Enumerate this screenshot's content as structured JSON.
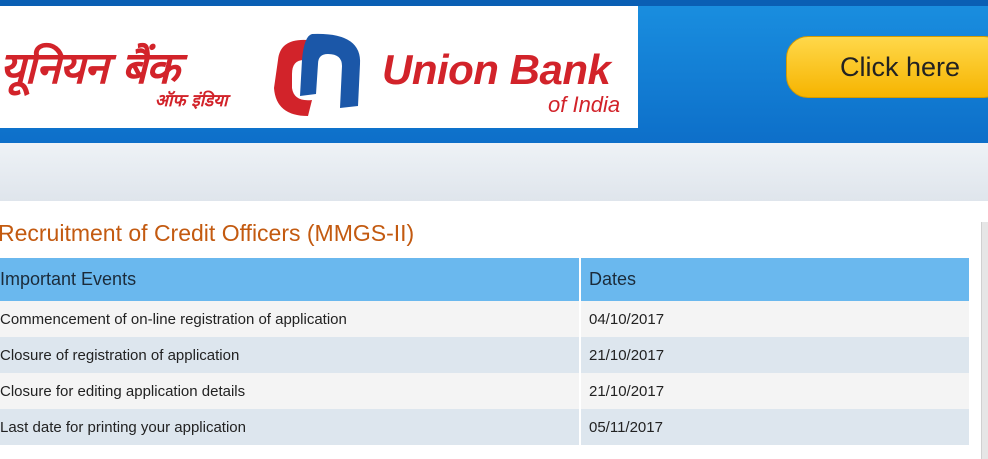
{
  "header": {
    "logo": {
      "hindi_name": "यूनियन बैंक",
      "hindi_sub": "ऑफ इंडिया",
      "english_name": "Union Bank",
      "english_sub": "of India"
    },
    "cta_button": "Click here"
  },
  "colors": {
    "header_blue": "#1a8fe0",
    "brand_red": "#d2232a",
    "brand_blue": "#1b57a8",
    "button_yellow": "#f6b400",
    "title_orange": "#c35a10",
    "table_header": "#6ab8ee"
  },
  "main": {
    "title": "Recruitment of Credit Officers (MMGS-II)",
    "table": {
      "headers": [
        "Important Events",
        "Dates"
      ],
      "rows": [
        {
          "event": "Commencement of on-line registration of application",
          "date": "04/10/2017"
        },
        {
          "event": "Closure of registration of application",
          "date": "21/10/2017"
        },
        {
          "event": "Closure for editing application details",
          "date": "21/10/2017"
        },
        {
          "event": "Last date for printing your application",
          "date": "05/11/2017"
        }
      ]
    }
  }
}
